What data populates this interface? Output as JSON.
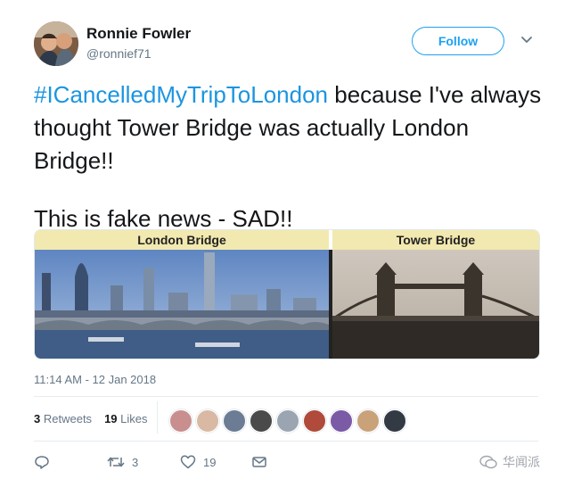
{
  "user": {
    "name": "Ronnie Fowler",
    "handle": "@ronnief71"
  },
  "follow_label": "Follow",
  "tweet": {
    "hashtag": "#ICancelledMyTripToLondon",
    "line1_rest": " because I've always thought Tower Bridge was actually London Bridge!!",
    "line2": "This is fake news - SAD!!"
  },
  "media": {
    "left_label": "London Bridge",
    "right_label": "Tower Bridge"
  },
  "timestamp": "11:14 AM - 12 Jan 2018",
  "stats": {
    "retweets_count": "3",
    "retweets_label": "Retweets",
    "likes_count": "19",
    "likes_label": "Likes"
  },
  "likers": [
    "#c98f8f",
    "#d9b9a3",
    "#6c7c94",
    "#4a4a4a",
    "#9aa5b1",
    "#b04a3a",
    "#7b5aa6",
    "#c9a27a",
    "#333a44"
  ],
  "actions": {
    "reply_icon": "reply-icon",
    "retweet_icon": "retweet-icon",
    "retweet_count": "3",
    "like_icon": "heart-icon",
    "like_count": "19",
    "dm_icon": "envelope-icon"
  },
  "watermark_text": "华闻派",
  "colors": {
    "accent": "#1da1f2",
    "hashtag": "#1b95e0",
    "muted": "#657786"
  }
}
